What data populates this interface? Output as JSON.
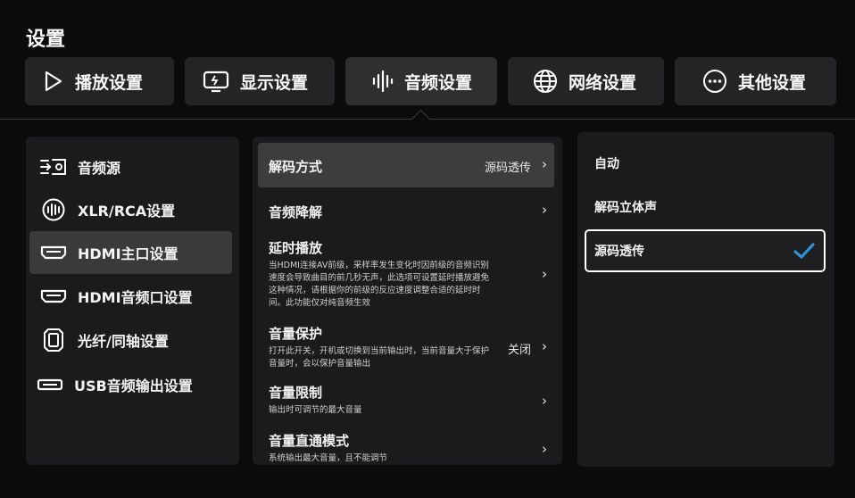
{
  "page": {
    "title": "设置"
  },
  "tabs": [
    {
      "label": "播放设置",
      "icon": "play-icon"
    },
    {
      "label": "显示设置",
      "icon": "display-icon"
    },
    {
      "label": "音频设置",
      "icon": "audio-wave-icon",
      "active": true
    },
    {
      "label": "网络设置",
      "icon": "globe-icon"
    },
    {
      "label": "其他设置",
      "icon": "more-icon"
    }
  ],
  "sidebar": {
    "items": [
      {
        "label": "音频源",
        "icon": "audio-source-icon"
      },
      {
        "label": "XLR/RCA设置",
        "icon": "xlr-icon"
      },
      {
        "label": "HDMI主口设置",
        "icon": "hdmi-icon",
        "active": true
      },
      {
        "label": "HDMI音频口设置",
        "icon": "hdmi-icon"
      },
      {
        "label": "光纤/同轴设置",
        "icon": "optical-icon"
      },
      {
        "label": "USB音频输出设置",
        "icon": "usb-icon"
      }
    ]
  },
  "settings": {
    "rows": [
      {
        "title": "解码方式",
        "value": "源码透传",
        "active": true
      },
      {
        "title": "音频降解"
      },
      {
        "title": "延时播放",
        "desc": "当HDMI连接AV前级，采样率发生变化时因前级的音频识别速度会导致曲目的前几秒无声，此选项可设置延时播放避免这种情况，请根据你的前级的反应速度调整合适的延时时间。此功能仅对纯音频生效"
      },
      {
        "title": "音量保护",
        "desc": "打开此开关，开机或切换到当前输出时，当前音量大于保护音量时，会以保护音量输出",
        "value": "关闭"
      },
      {
        "title": "音量限制",
        "desc": "输出时可调节的最大音量"
      },
      {
        "title": "音量直通模式",
        "desc": "系统输出最大音量，且不能调节"
      }
    ]
  },
  "options": {
    "items": [
      {
        "label": "自动"
      },
      {
        "label": "解码立体声"
      },
      {
        "label": "源码透传",
        "selected": true
      }
    ],
    "accent": "#2f8fd8"
  }
}
